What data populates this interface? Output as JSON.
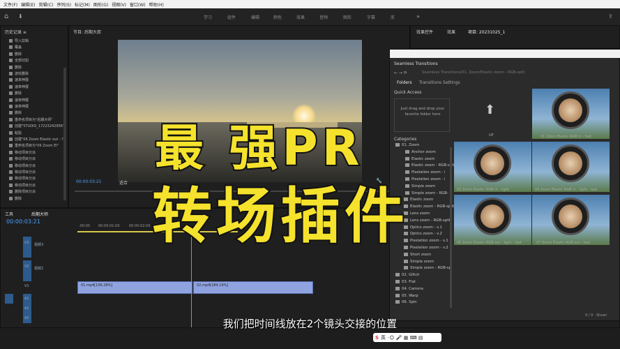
{
  "menu": [
    "文件(F)",
    "编辑(E)",
    "剪辑(C)",
    "序列(S)",
    "标记(M)",
    "图形(G)",
    "视图(V)",
    "窗口(W)",
    "帮助(H)"
  ],
  "workspaces": [
    "学习",
    "组件",
    "编辑",
    "颜色",
    "效果",
    "音频",
    "图形",
    "字幕",
    "库"
  ],
  "history": {
    "title": "历史记录 ≡",
    "items": [
      "导入剪辑",
      "覆盖",
      "删除",
      "全部切割",
      "删除",
      "波纹删除",
      "速率伸展",
      "速率伸展",
      "删除",
      "速率伸展",
      "速率伸展",
      "删除",
      "重命名项目为\"后期大师\"",
      "创建\"STUDIO_17223242956\"",
      "粘贴",
      "创建\"06 Zoom Elastic out - l\"",
      "重命名项目为\"06 Zoom El\"",
      "移动项目分派",
      "移动项目分派",
      "移动项目分派",
      "移动项目分派",
      "移动项目分派",
      "移动项目分派",
      "删除项目分派",
      "删除"
    ]
  },
  "program": {
    "title": "节目: 后期大叔",
    "timecode": "00:00:03:21",
    "fit": "适合"
  },
  "right_tabs": [
    "效果控件",
    "效果",
    "项目: 20231025_1"
  ],
  "timeline": {
    "tabs": [
      "工具",
      "后期大师"
    ],
    "timecode": "00:00:03:21",
    "ruler": [
      ":00:00",
      "00:00:01:00",
      "00:00:02:00"
    ],
    "tracks": [
      {
        "name": "V3",
        "label": "视频3"
      },
      {
        "name": "V2",
        "label": "视频2"
      },
      {
        "name": "V1",
        "label": ""
      },
      {
        "name": "A1",
        "label": ""
      },
      {
        "name": "A2",
        "label": ""
      },
      {
        "name": "A3",
        "label": ""
      }
    ],
    "clips": [
      "01.mp4[136.28%]",
      "02.mp4[184.19%]"
    ]
  },
  "seamless": {
    "title": "Seamless Transitions",
    "path": "Seamless Transitions/01. Zoom/Elastic zoom - RGB-split",
    "tabs": [
      "Folders",
      "Transitions Settings"
    ],
    "quick_access": "Quick Access",
    "drop_hint": "Just drag and drop your favorite folder here",
    "categories_title": "Categories",
    "up_label": "UP",
    "footer": "9 / 9 · Showi",
    "categories": [
      "01. Zoom",
      "Anchor zoom",
      "Elastic zoom",
      "Elastic zoom - RGB-split",
      "Pixelation zoom - i",
      "Pixelation zoom - i",
      "Simple zoom",
      "Simple zoom - RGB-",
      "Elastic zoom",
      "Elastic zoom - RGB-split",
      "Lens zoom",
      "Lens zoom - RGB-split",
      "Optics zoom - v.1",
      "Optics zoom - v.2",
      "Pixelation zoom - v.1",
      "Pixelation zoom - v.2",
      "Short zoom",
      "Simple zoom",
      "Simple zoom - RGB-sp",
      "02. Glitch",
      "03. Flat",
      "04. Camera",
      "05. Warp",
      "06. Spin"
    ],
    "thumbnails": [
      "01 Zoom Elastic RGB in - fast",
      "03 Zoom Elastic RGB in - light",
      "04 Zoom Elastic RGB in - light - fast",
      "06 Zoom Elastic RGB out - light - fast",
      "07 Zoom Elastic RGB out - fast"
    ]
  },
  "overlay": {
    "title_line1": "最 强PR",
    "title_line2": "转场插件",
    "subtitle": "我们把时间线放在2个镜头交接的位置"
  },
  "colors": {
    "accent_yellow": "#f5e22c",
    "clip_blue": "#8fa3e0",
    "timecode_blue": "#4aa3ff"
  }
}
